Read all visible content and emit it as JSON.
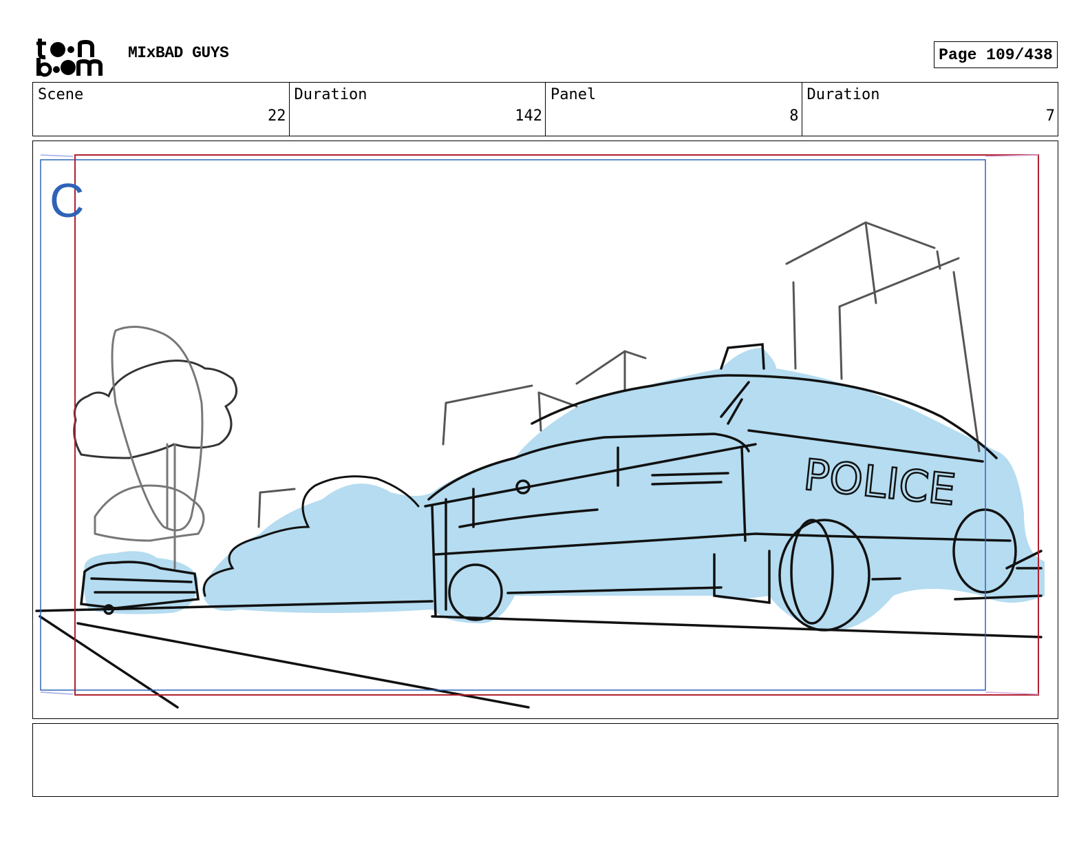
{
  "header": {
    "logo_text_top": "toon",
    "logo_text_bottom": "boom",
    "project_title": "MIxBAD GUYS",
    "page_label": "Page 109/438"
  },
  "info": {
    "scene_label": "Scene",
    "scene_value": "22",
    "scene_duration_label": "Duration",
    "scene_duration_value": "142",
    "panel_label": "Panel",
    "panel_value": "8",
    "panel_duration_label": "Duration",
    "panel_duration_value": "7"
  },
  "panel": {
    "camera_label": "C",
    "sketch_text": "POLICE",
    "colors": {
      "camera_frame": "#2e63b8",
      "safe_frame": "#b01e2e",
      "fill": "#b5dcf0",
      "line": "#1c1c1c"
    }
  },
  "notes": {
    "text": ""
  }
}
